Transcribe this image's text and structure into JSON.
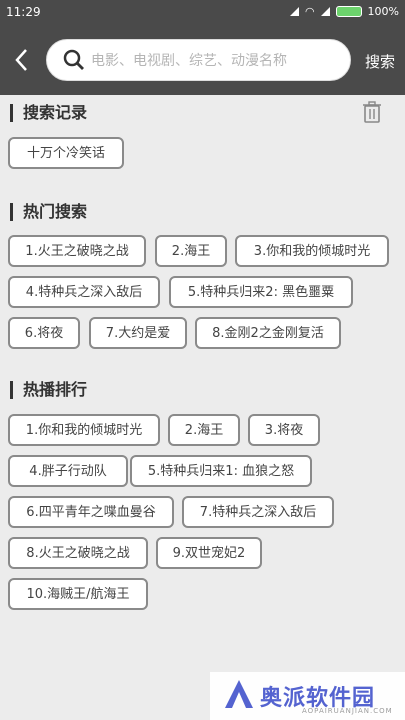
{
  "status_bar": {
    "time": "11:29",
    "battery": "100%"
  },
  "header": {
    "search_placeholder": "电影、电视剧、综艺、动漫名称",
    "search_button": "搜索"
  },
  "history": {
    "title": "搜索记录",
    "items": [
      "十万个冷笑话"
    ]
  },
  "hot": {
    "title": "热门搜索",
    "items": [
      "1.火王之破晓之战",
      "2.海王",
      "3.你和我的倾城时光",
      "4.特种兵之深入敌后",
      "5.特种兵归来2: 黑色噩粟",
      "6.将夜",
      "7.大约是爱",
      "8.金刚2之金刚复活"
    ]
  },
  "ranking": {
    "title": "热播排行",
    "items": [
      "1.你和我的倾城时光",
      "2.海王",
      "3.将夜",
      "4.胖子行动队",
      "5.特种兵归来1: 血狼之怒",
      "6.四平青年之喋血曼谷",
      "7.特种兵之深入敌后",
      "8.火王之破晓之战",
      "9.双世宠妃2",
      "10.海贼王/航海王"
    ]
  },
  "watermark": {
    "text": "奥派软件园",
    "sub": "AOPAIRUANJIAN.COM"
  },
  "colors": {
    "header": "#4a4a4a",
    "battery": "#6dd36d",
    "brand": "#4c5ccf"
  }
}
